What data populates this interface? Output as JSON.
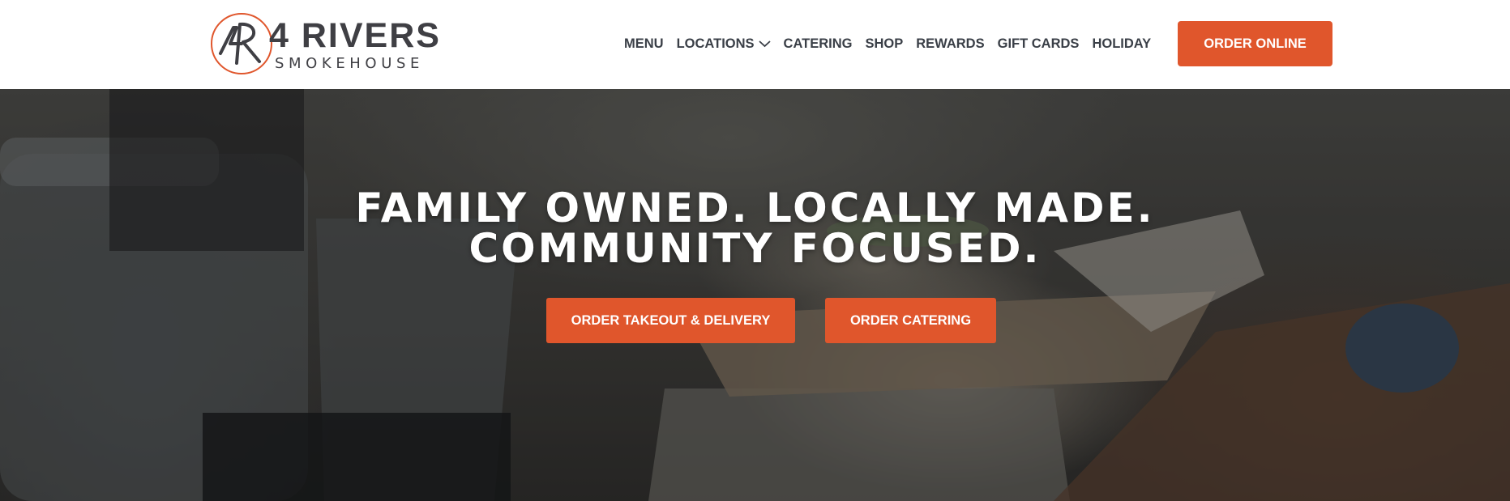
{
  "brand": {
    "mark_text": "4R",
    "title": "4 RIVERS",
    "subtitle": "SMOKEHOUSE",
    "accent_color": "#e0562c",
    "text_color": "#3f3f44"
  },
  "nav": {
    "items": [
      {
        "label": "MENU"
      },
      {
        "label": "LOCATIONS",
        "icon": "chevron-down-icon"
      },
      {
        "label": "CATERING"
      },
      {
        "label": "SHOP"
      },
      {
        "label": "REWARDS"
      },
      {
        "label": "GIFT CARDS"
      },
      {
        "label": "HOLIDAY"
      }
    ],
    "order_online_label": "ORDER ONLINE"
  },
  "hero": {
    "headline_line1": "FAMILY OWNED. LOCALLY MADE.",
    "headline_line2": "COMMUNITY FOCUSED.",
    "cta_takeout_label": "ORDER TAKEOUT & DELIVERY",
    "cta_catering_label": "ORDER CATERING",
    "background_image": "blurred-restaurant-food-photo"
  }
}
